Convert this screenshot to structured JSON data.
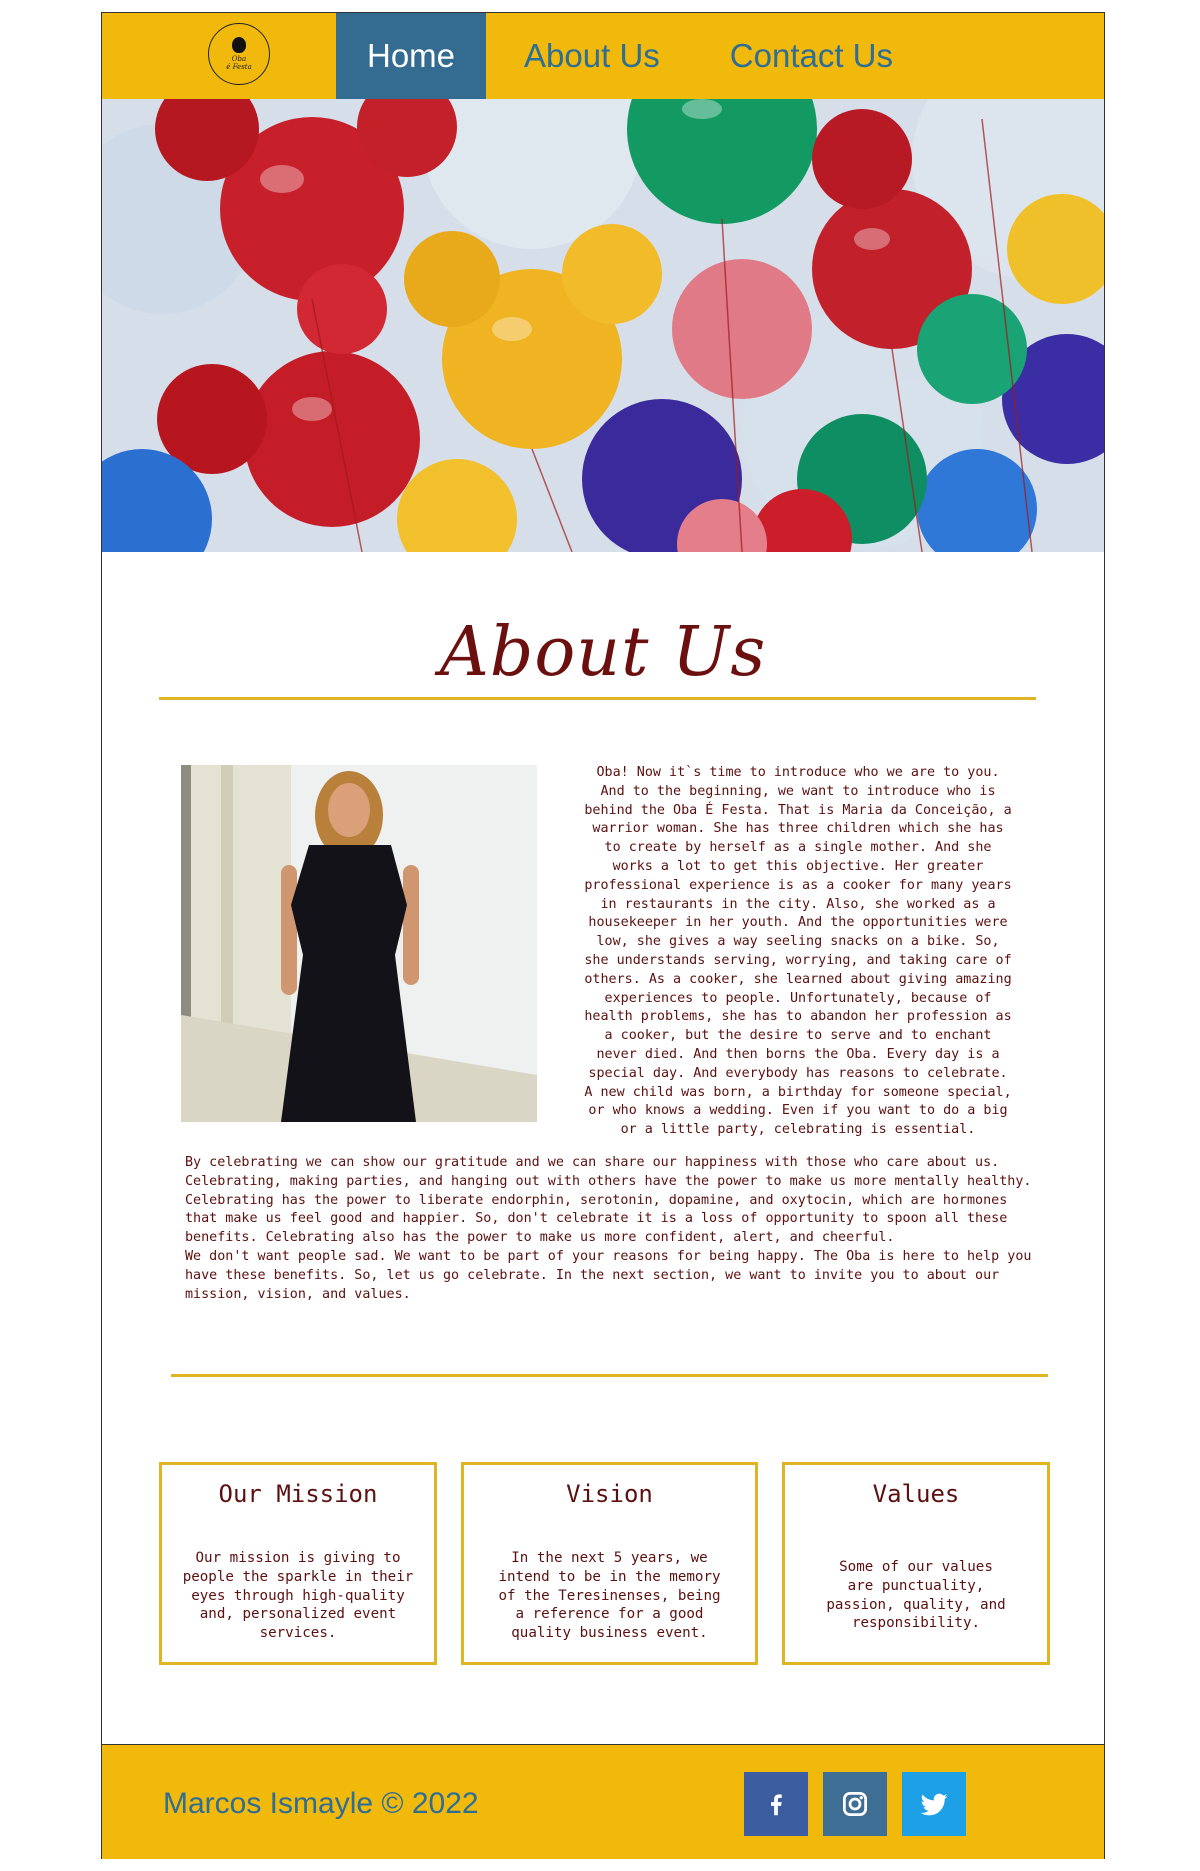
{
  "header": {
    "logo": {
      "icon": "balloon-logo-icon",
      "text_line1": "Oba",
      "text_line2": "é Festa"
    },
    "nav": [
      {
        "label": "Home",
        "active": true
      },
      {
        "label": "About Us",
        "active": false
      },
      {
        "label": "Contact Us",
        "active": false
      }
    ]
  },
  "hero": {
    "image": "colorful-mickey-balloons-photo"
  },
  "about": {
    "title": "About Us",
    "photo": "woman-in-black-dress-photo",
    "intro": "Oba! Now it`s time to introduce who we are to you.\nAnd to the beginning, we want to introduce who is\nbehind the Oba É Festa. That is Maria da Conceição, a\nwarrior woman. She has three children which she has\nto create by herself as a single mother. And she\nworks a lot to get this objective. Her greater\nprofessional experience is as a cooker for many years\nin restaurants in the city. Also, she worked as a\nhousekeeper in her youth. And the opportunities were\nlow, she gives a way seeling snacks on a bike. So,\nshe understands serving, worrying, and taking care of\nothers. As a cooker, she learned about giving amazing\nexperiences to people. Unfortunately, because of\nhealth problems, she has to abandon her profession as\na cooker, but the desire to serve and to enchant\nnever died. And then borns the Oba. Every day is a\nspecial day. And everybody has reasons to celebrate.\nA new child was born, a birthday for someone special,\nor who knows a wedding. Even if you want to do a big\nor a little party, celebrating is essential.",
    "body": "By celebrating we can show our gratitude and we can share our happiness with those who care about us.\nCelebrating, making parties, and hanging out with others have the power to make us more mentally healthy.\nCelebrating has the power to liberate endorphin, serotonin, dopamine, and oxytocin, which are hormones\nthat make us feel good and happier. So, don't celebrate it is a loss of opportunity to spoon all these\nbenefits. Celebrating also has the power to make us more confident, alert, and cheerful.\nWe don't want people sad. We want to be part of your reasons for being happy. The Oba is here to help you\nhave these benefits. So, let us go celebrate. In the next section, we want to invite you to about our\nmission, vision, and values."
  },
  "cards": [
    {
      "title": "Our Mission",
      "text": "Our mission is giving to\npeople the sparkle in their\neyes through high-quality\nand, personalized event\nservices."
    },
    {
      "title": "Vision",
      "text": "In the next 5 years, we\nintend to be in the memory\nof the Teresinenses, being\na reference for a good\nquality business event."
    },
    {
      "title": "Values",
      "text": "Some of our values\nare punctuality,\npassion, quality, and\nresponsibility."
    }
  ],
  "footer": {
    "copyright": "Marcos Ismayle © 2022",
    "social": [
      {
        "icon": "facebook-icon",
        "color": "#3b5c9e"
      },
      {
        "icon": "instagram-icon",
        "color": "#3f6e94"
      },
      {
        "icon": "twitter-icon",
        "color": "#1ea0e6"
      }
    ]
  },
  "colors": {
    "accent": "#f0b90b",
    "nav_active": "#346b91",
    "link": "#2e6e94",
    "text": "#5c1010",
    "rule": "#e0b524"
  }
}
